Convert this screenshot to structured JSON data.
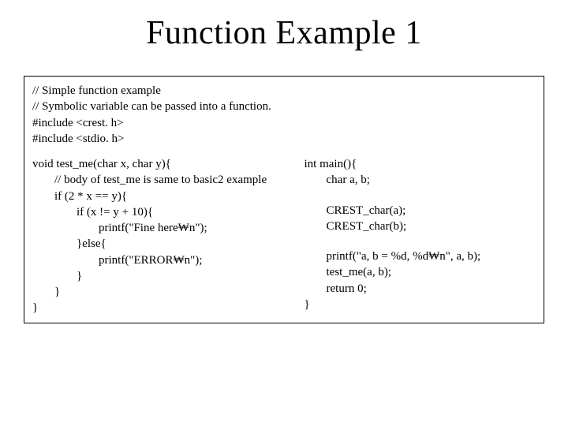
{
  "title": "Function Example 1",
  "header": {
    "l1": "// Simple function example",
    "l2": "// Symbolic variable can be passed into a function.",
    "l3": "#include <crest. h>",
    "l4": "#include <stdio. h>"
  },
  "left": {
    "l1": "void test_me(char x, char y){",
    "l2": "// body of test_me is same to basic2 example",
    "l3": "if (2 * x == y){",
    "l4": "if (x != y + 10){",
    "l5": "printf(\"Fine here₩n\");",
    "l6": "}else{",
    "l7": "printf(\"ERROR₩n\");",
    "l8": "}",
    "l9": "}",
    "l10": "}"
  },
  "right": {
    "l1": "int main(){",
    "l2": "char a, b;",
    "l3": "CREST_char(a);",
    "l4": "CREST_char(b);",
    "l5": "printf(\"a, b = %d, %d₩n\", a, b);",
    "l6": "test_me(a, b);",
    "l7": "return 0;",
    "l8": "}"
  }
}
